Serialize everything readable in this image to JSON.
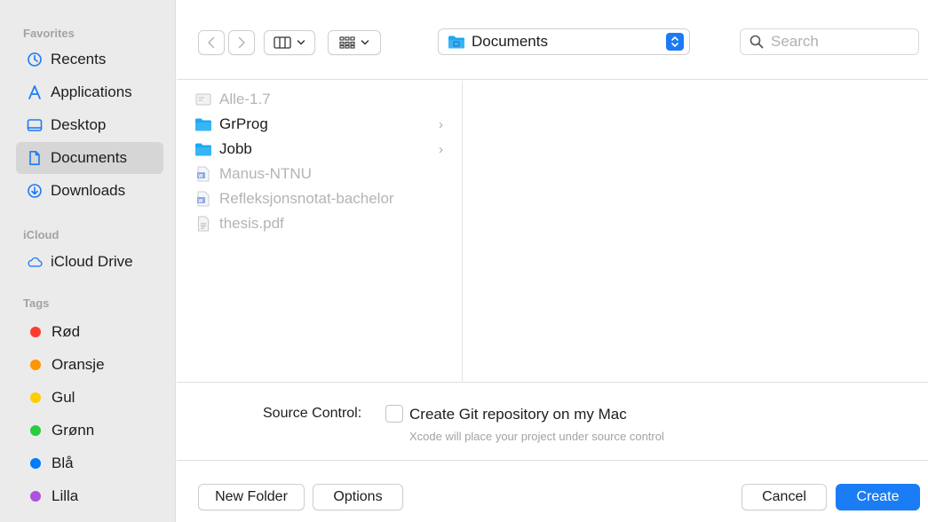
{
  "sidebar": {
    "sections": [
      {
        "title": "Favorites"
      },
      {
        "title": "iCloud"
      },
      {
        "title": "Tags"
      }
    ],
    "favorites": [
      {
        "label": "Recents",
        "icon": "clock-icon"
      },
      {
        "label": "Applications",
        "icon": "applications-icon"
      },
      {
        "label": "Desktop",
        "icon": "desktop-icon"
      },
      {
        "label": "Documents",
        "icon": "document-icon",
        "selected": true
      },
      {
        "label": "Downloads",
        "icon": "download-icon"
      }
    ],
    "icloud": [
      {
        "label": "iCloud Drive",
        "icon": "cloud-icon"
      }
    ],
    "tags": [
      {
        "label": "Rød",
        "color": "#ff3b30"
      },
      {
        "label": "Oransje",
        "color": "#ff9500"
      },
      {
        "label": "Gul",
        "color": "#ffcc00"
      },
      {
        "label": "Grønn",
        "color": "#28cd41"
      },
      {
        "label": "Blå",
        "color": "#007aff"
      },
      {
        "label": "Lilla",
        "color": "#af52de"
      }
    ]
  },
  "toolbar": {
    "location": "Documents",
    "search_placeholder": "Search",
    "accent": "#1d7af5"
  },
  "files": [
    {
      "name": "Alle-1.7",
      "icon": "file-icon",
      "dim": true,
      "folder": false
    },
    {
      "name": "GrProg",
      "icon": "folder-icon",
      "dim": false,
      "folder": true
    },
    {
      "name": "Jobb",
      "icon": "folder-icon",
      "dim": false,
      "folder": true
    },
    {
      "name": "Manus-NTNU",
      "icon": "word-doc-icon",
      "dim": true,
      "folder": false
    },
    {
      "name": "Refleksjonsnotat-bachelor",
      "icon": "word-doc-icon",
      "dim": true,
      "folder": false
    },
    {
      "name": "thesis.pdf",
      "icon": "pdf-icon",
      "dim": true,
      "folder": false
    }
  ],
  "options": {
    "source_control_label": "Source Control:",
    "checkbox_label": "Create Git repository on my Mac",
    "checkbox_hint": "Xcode will place your project under source control",
    "checked": false
  },
  "buttons": {
    "new_folder": "New Folder",
    "options": "Options",
    "cancel": "Cancel",
    "create": "Create"
  }
}
